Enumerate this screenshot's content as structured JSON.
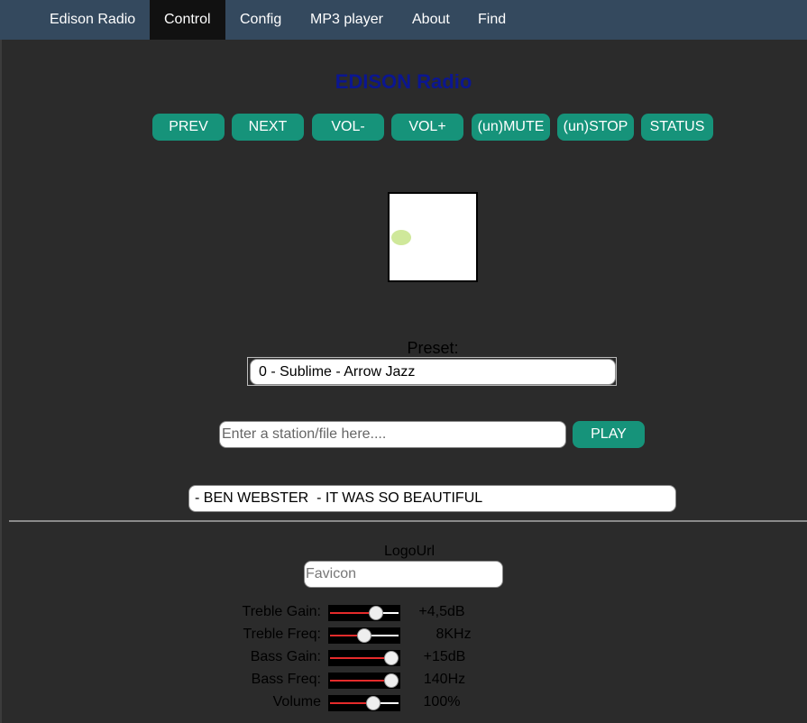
{
  "nav": {
    "items": [
      {
        "label": "Edison Radio",
        "active": false
      },
      {
        "label": "Control",
        "active": true
      },
      {
        "label": "Config",
        "active": false
      },
      {
        "label": "MP3 player",
        "active": false
      },
      {
        "label": "About",
        "active": false
      },
      {
        "label": "Find",
        "active": false
      }
    ]
  },
  "page_title": "EDISON Radio",
  "controls": {
    "prev": "PREV",
    "next": "NEXT",
    "vol_down": "VOL-",
    "vol_up": "VOL+",
    "mute": "(un)MUTE",
    "stop": "(un)STOP",
    "status": "STATUS"
  },
  "preset": {
    "label": "Preset:",
    "selected": "0 - Sublime - Arrow Jazz"
  },
  "station": {
    "placeholder": "Enter a station/file here....",
    "value": "",
    "play_label": "PLAY"
  },
  "now_playing": "- BEN WEBSTER  - IT WAS SO BEAUTIFUL",
  "logo_url": {
    "label": "LogoUrl",
    "placeholder": "Favicon",
    "value": ""
  },
  "tone": [
    {
      "label": "Treble Gain:",
      "value": "+4,5dB",
      "level": 0.72
    },
    {
      "label": "Treble Freq:",
      "value": "8KHz",
      "level": 0.5
    },
    {
      "label": "Bass Gain:",
      "value": "+15dB",
      "level": 1.0
    },
    {
      "label": "Bass Freq:",
      "value": "140Hz",
      "level": 1.0
    },
    {
      "label": "Volume",
      "value": "100%",
      "level": 0.66
    }
  ],
  "colors": {
    "nav_bg": "#34495e",
    "nav_active": "#111111",
    "button": "#16937a",
    "title": "#0b1690",
    "background": "#2b2b2b",
    "slider_fill": "#e52b2b"
  }
}
